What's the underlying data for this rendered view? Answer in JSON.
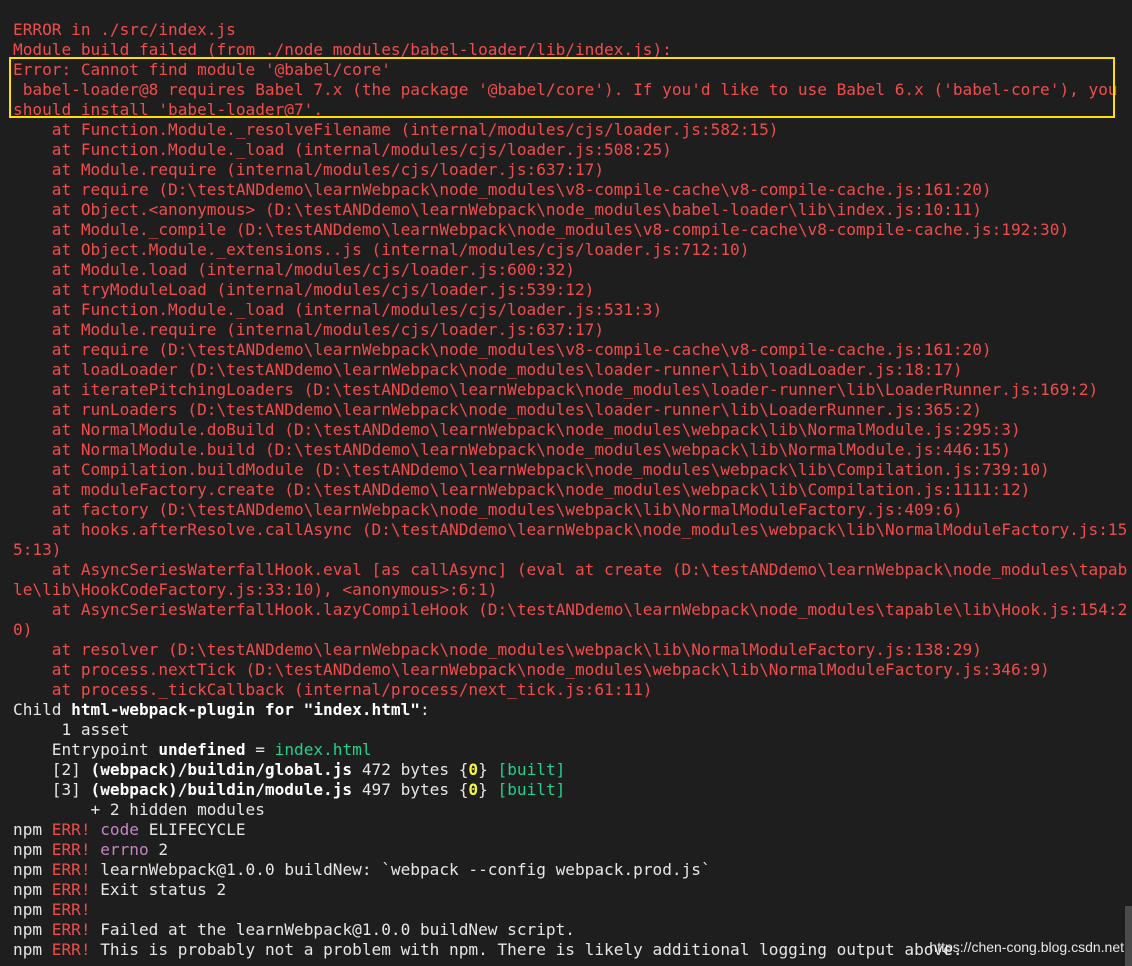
{
  "error_block": {
    "header_1": "ERROR in ./src/index.js",
    "header_2": "Module build failed (from ./node_modules/babel-loader/lib/index.js):",
    "highlight_1": "Error: Cannot find module '@babel/core'",
    "highlight_2": " babel-loader@8 requires Babel 7.x (the package '@babel/core'). If you'd like to use Babel 6.x ('babel-core'), you",
    "highlight_3": "should install 'babel-loader@7'.",
    "stack": [
      "    at Function.Module._resolveFilename (internal/modules/cjs/loader.js:582:15)",
      "    at Function.Module._load (internal/modules/cjs/loader.js:508:25)",
      "    at Module.require (internal/modules/cjs/loader.js:637:17)",
      "    at require (D:\\testANDdemo\\learnWebpack\\node_modules\\v8-compile-cache\\v8-compile-cache.js:161:20)",
      "    at Object.<anonymous> (D:\\testANDdemo\\learnWebpack\\node_modules\\babel-loader\\lib\\index.js:10:11)",
      "    at Module._compile (D:\\testANDdemo\\learnWebpack\\node_modules\\v8-compile-cache\\v8-compile-cache.js:192:30)",
      "    at Object.Module._extensions..js (internal/modules/cjs/loader.js:712:10)",
      "    at Module.load (internal/modules/cjs/loader.js:600:32)",
      "    at tryModuleLoad (internal/modules/cjs/loader.js:539:12)",
      "    at Function.Module._load (internal/modules/cjs/loader.js:531:3)",
      "    at Module.require (internal/modules/cjs/loader.js:637:17)",
      "    at require (D:\\testANDdemo\\learnWebpack\\node_modules\\v8-compile-cache\\v8-compile-cache.js:161:20)",
      "    at loadLoader (D:\\testANDdemo\\learnWebpack\\node_modules\\loader-runner\\lib\\loadLoader.js:18:17)",
      "    at iteratePitchingLoaders (D:\\testANDdemo\\learnWebpack\\node_modules\\loader-runner\\lib\\LoaderRunner.js:169:2)",
      "    at runLoaders (D:\\testANDdemo\\learnWebpack\\node_modules\\loader-runner\\lib\\LoaderRunner.js:365:2)",
      "    at NormalModule.doBuild (D:\\testANDdemo\\learnWebpack\\node_modules\\webpack\\lib\\NormalModule.js:295:3)",
      "    at NormalModule.build (D:\\testANDdemo\\learnWebpack\\node_modules\\webpack\\lib\\NormalModule.js:446:15)",
      "    at Compilation.buildModule (D:\\testANDdemo\\learnWebpack\\node_modules\\webpack\\lib\\Compilation.js:739:10)",
      "    at moduleFactory.create (D:\\testANDdemo\\learnWebpack\\node_modules\\webpack\\lib\\Compilation.js:1111:12)",
      "    at factory (D:\\testANDdemo\\learnWebpack\\node_modules\\webpack\\lib\\NormalModuleFactory.js:409:6)",
      "    at hooks.afterResolve.callAsync (D:\\testANDdemo\\learnWebpack\\node_modules\\webpack\\lib\\NormalModuleFactory.js:15",
      "5:13)",
      "    at AsyncSeriesWaterfallHook.eval [as callAsync] (eval at create (D:\\testANDdemo\\learnWebpack\\node_modules\\tapab",
      "le\\lib\\HookCodeFactory.js:33:10), <anonymous>:6:1)",
      "    at AsyncSeriesWaterfallHook.lazyCompileHook (D:\\testANDdemo\\learnWebpack\\node_modules\\tapable\\lib\\Hook.js:154:2",
      "0)",
      "    at resolver (D:\\testANDdemo\\learnWebpack\\node_modules\\webpack\\lib\\NormalModuleFactory.js:138:29)",
      "    at process.nextTick (D:\\testANDdemo\\learnWebpack\\node_modules\\webpack\\lib\\NormalModuleFactory.js:346:9)",
      "    at process._tickCallback (internal/process/next_tick.js:61:11)"
    ]
  },
  "child_block": {
    "child_prefix": "Child ",
    "child_name": "html-webpack-plugin for \"index.html\"",
    "child_suffix": ":",
    "asset_line": "     1 asset",
    "entry_prefix": "    Entrypoint ",
    "entry_undefined": "undefined",
    "entry_eq": " = ",
    "entry_file": "index.html",
    "mod2_idx": "    [2] ",
    "mod2_path": "(webpack)/buildin/global.js",
    "mod2_size": " 472 bytes {",
    "mod2_chunk": "0",
    "mod2_close": "} ",
    "mod2_built": "[built]",
    "mod3_idx": "    [3] ",
    "mod3_path": "(webpack)/buildin/module.js",
    "mod3_size": " 497 bytes {",
    "mod3_chunk": "0",
    "mod3_close": "} ",
    "mod3_built": "[built]",
    "hidden": "        + 2 hidden modules"
  },
  "npm_block": {
    "npm": "npm ",
    "err": "ERR!",
    "lines": [
      {
        "key": "code",
        "rest": " ELIFECYCLE"
      },
      {
        "key": "errno",
        "rest": " 2"
      },
      {
        "key": "",
        "rest": " learnWebpack@1.0.0 buildNew: `webpack --config webpack.prod.js`"
      },
      {
        "key": "",
        "rest": " Exit status 2"
      },
      {
        "key": "",
        "rest": ""
      },
      {
        "key": "",
        "rest": " Failed at the learnWebpack@1.0.0 buildNew script."
      },
      {
        "key": "",
        "rest": " This is probably not a problem with npm. There is likely additional logging output above."
      }
    ]
  },
  "watermark": "https://chen-cong.blog.csdn.net",
  "colors": {
    "background": "#1e1e1e",
    "error_red": "#f14c4c",
    "highlight_box": "#ffe100",
    "cyan": "#29b8db",
    "green": "#23d18b",
    "yellow": "#f5f543",
    "magenta": "#c586c0"
  }
}
